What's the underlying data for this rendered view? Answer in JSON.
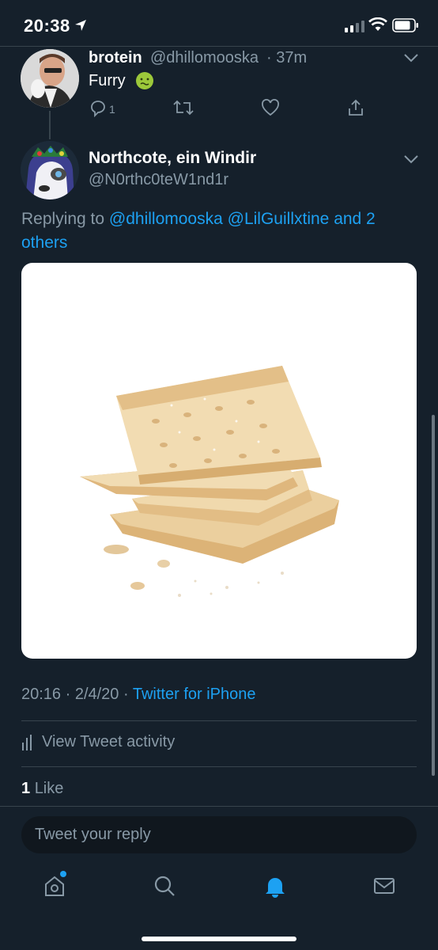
{
  "status_bar": {
    "time": "20:38"
  },
  "parent_tweet": {
    "display_name": "brotein",
    "handle": "@dhillomooska",
    "time_ago": "· 37m",
    "text": "Furry",
    "reply_count": "1"
  },
  "main_tweet": {
    "display_name": "Northcote, ein Windir",
    "handle": "@N0rthc0teW1nd1r",
    "replying_prefix": "Replying to",
    "replying_mention_1": "@dhillomooska",
    "replying_mention_2": "@LilGuillxtine",
    "replying_and": "and 2",
    "replying_others": "others",
    "timestamp": "20:16 · 2/4/20 ·",
    "source": "Twitter for iPhone",
    "view_activity": "View Tweet activity",
    "like_count": "1",
    "like_label": "Like"
  },
  "reply_box": {
    "placeholder": "Tweet your reply"
  },
  "colors": {
    "background": "#15202b",
    "accent": "#1da1f2",
    "muted": "#8899a6",
    "divider": "#38444d"
  }
}
